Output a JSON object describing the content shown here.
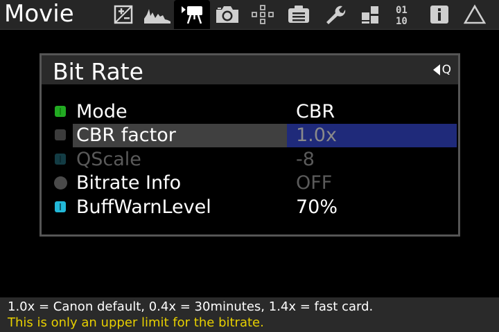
{
  "header": {
    "mode_title": "Movie",
    "tabs": [
      {
        "icon": "exposure-icon",
        "active": false
      },
      {
        "icon": "histogram-icon",
        "active": false
      },
      {
        "icon": "movie-camera-icon",
        "active": true
      },
      {
        "icon": "camera-icon",
        "active": false
      },
      {
        "icon": "focus-points-icon",
        "active": false
      },
      {
        "icon": "display-icon",
        "active": false
      },
      {
        "icon": "wrench-icon",
        "active": false
      },
      {
        "icon": "modules-icon",
        "active": false
      },
      {
        "icon": "binary-debug-icon",
        "active": false
      },
      {
        "icon": "info-icon",
        "active": false
      },
      {
        "icon": "delta-icon",
        "active": false
      }
    ]
  },
  "dialog": {
    "title": "Bit Rate",
    "q_hint": "Q",
    "rows": [
      {
        "label": "Mode",
        "value": "CBR",
        "icon": "green-square-icon",
        "selected": false,
        "disabled": false
      },
      {
        "label": "CBR factor",
        "value": "1.0x",
        "icon": "gray-square-icon",
        "selected": true,
        "disabled": false
      },
      {
        "label": "QScale",
        "value": "-8",
        "icon": "teal-bar-icon",
        "selected": false,
        "disabled": true
      },
      {
        "label": "Bitrate Info",
        "value": "OFF",
        "icon": "gray-circle-icon",
        "selected": false,
        "disabled": false
      },
      {
        "label": "BuffWarnLevel",
        "value": "70%",
        "icon": "cyan-bar-icon",
        "selected": false,
        "disabled": false
      }
    ]
  },
  "help": {
    "line1": "1.0x = Canon default, 0.4x = 30minutes, 1.4x = fast card.",
    "line2": "This is only an upper limit for the bitrate."
  },
  "colors": {
    "selected_value_bg": "#1f2a7a",
    "selected_label_bg": "#404040",
    "warning_text": "#e8d000",
    "green_icon": "#22aa22",
    "cyan_icon": "#22b8d8"
  }
}
